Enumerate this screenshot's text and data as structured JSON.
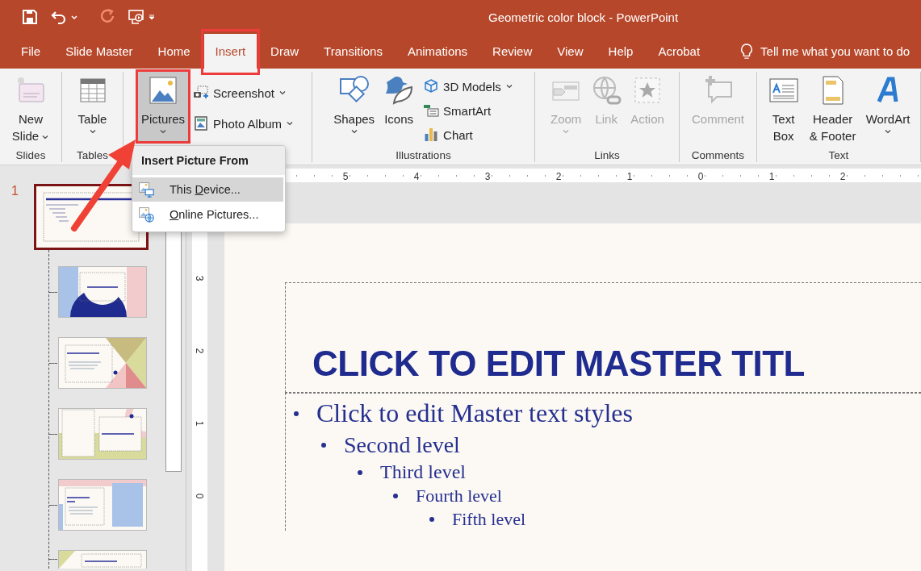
{
  "window": {
    "title": "Geometric color block  -  PowerPoint"
  },
  "tabs": [
    {
      "label": "File",
      "selected": false,
      "highlighted": false
    },
    {
      "label": "Slide Master",
      "selected": false,
      "highlighted": false
    },
    {
      "label": "Home",
      "selected": false,
      "highlighted": false
    },
    {
      "label": "Insert",
      "selected": true,
      "highlighted": true
    },
    {
      "label": "Draw",
      "selected": false,
      "highlighted": false
    },
    {
      "label": "Transitions",
      "selected": false,
      "highlighted": false
    },
    {
      "label": "Animations",
      "selected": false,
      "highlighted": false
    },
    {
      "label": "Review",
      "selected": false,
      "highlighted": false
    },
    {
      "label": "View",
      "selected": false,
      "highlighted": false
    },
    {
      "label": "Help",
      "selected": false,
      "highlighted": false
    },
    {
      "label": "Acrobat",
      "selected": false,
      "highlighted": false
    }
  ],
  "tell_me": {
    "label": "Tell me what you want to do"
  },
  "ribbon": {
    "groups": [
      {
        "label": "Slides",
        "items": [
          {
            "kind": "large",
            "label": "New Slide",
            "dropdown": true,
            "disabled": false
          }
        ]
      },
      {
        "label": "Tables",
        "items": [
          {
            "kind": "large",
            "label": "Table",
            "dropdown": true,
            "disabled": false
          }
        ]
      },
      {
        "items": [
          {
            "kind": "large",
            "label": "Pictures",
            "dropdown": true,
            "disabled": false,
            "selected": true,
            "highlighted": true
          },
          {
            "kind": "small",
            "label": "Screenshot",
            "dropdown": true,
            "disabled": false
          },
          {
            "kind": "small",
            "label": "Photo Album",
            "dropdown": true,
            "disabled": false
          }
        ]
      },
      {
        "label": "Illustrations",
        "items": [
          {
            "kind": "large",
            "label": "Shapes",
            "dropdown": true,
            "disabled": false
          },
          {
            "kind": "large",
            "label": "Icons",
            "disabled": false
          },
          {
            "kind": "small",
            "label": "3D Models",
            "dropdown": true,
            "disabled": false
          },
          {
            "kind": "small",
            "label": "SmartArt",
            "disabled": false
          },
          {
            "kind": "small",
            "label": "Chart",
            "disabled": false
          }
        ]
      },
      {
        "label": "Links",
        "items": [
          {
            "kind": "large",
            "label": "Zoom",
            "dropdown": true,
            "disabled": true
          },
          {
            "kind": "large",
            "label": "Link",
            "disabled": true
          },
          {
            "kind": "large",
            "label": "Action",
            "disabled": true
          }
        ]
      },
      {
        "label": "Comments",
        "items": [
          {
            "kind": "large",
            "label": "Comment",
            "disabled": true
          }
        ]
      },
      {
        "label": "Text",
        "items": [
          {
            "kind": "large",
            "label": "Text Box",
            "disabled": false
          },
          {
            "kind": "large",
            "label": "Header & Footer",
            "disabled": false
          },
          {
            "kind": "large",
            "label": "WordArt",
            "dropdown": true,
            "disabled": false
          }
        ]
      }
    ]
  },
  "picture_menu": {
    "title": "Insert Picture From",
    "items": [
      {
        "label_before": "This ",
        "access_key": "D",
        "label_after": "evice...",
        "selected": true
      },
      {
        "access_key": "O",
        "label_after": "nline Pictures...",
        "selected": false
      }
    ]
  },
  "slides_pane": {
    "master": {
      "number": "1",
      "selected": true,
      "layouts": [
        {
          "kind": "arch"
        },
        {
          "kind": "triangles"
        },
        {
          "kind": "split"
        },
        {
          "kind": "panel"
        },
        {
          "kind": "cut"
        }
      ]
    }
  },
  "horizontal_ruler": [
    "5",
    "4",
    "3",
    "2",
    "1",
    "0",
    "1",
    "2"
  ],
  "vertical_ruler": [
    "3",
    "2",
    "1",
    "0"
  ],
  "slide": {
    "title": "CLICK TO EDIT MASTER TITL",
    "bullets": [
      {
        "text": "Click to edit Master text styles",
        "children": [
          {
            "text": "Second level",
            "children": [
              {
                "text": "Third level",
                "children": [
                  {
                    "text": "Fourth level",
                    "children": [
                      {
                        "text": "Fifth level"
                      }
                    ]
                  }
                ]
              }
            ]
          }
        ]
      }
    ]
  }
}
